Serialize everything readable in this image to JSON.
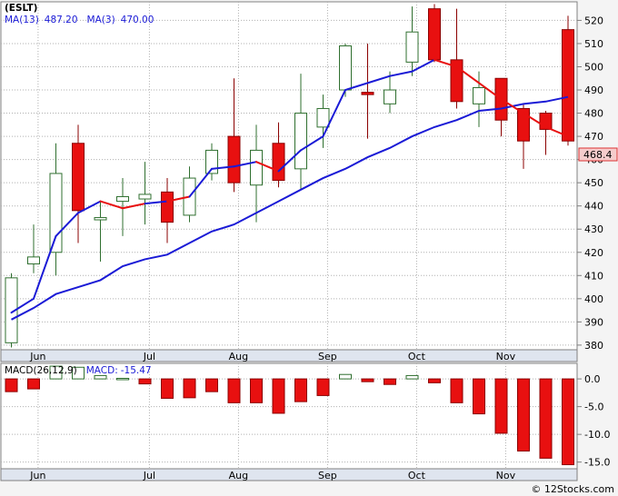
{
  "chart_data": [
    {
      "type": "candlestick",
      "ticker": "(ESLT)",
      "legend": [
        {
          "label": "MA(13)",
          "value": "487.20",
          "color": "#1a1ad6"
        },
        {
          "label": "MA(3)",
          "value": "470.00",
          "color": "#1a1ad6"
        }
      ],
      "last_price_label": "468.4",
      "ylim": [
        378,
        528
      ],
      "y_ticks": [
        380,
        390,
        400,
        410,
        420,
        430,
        440,
        450,
        460,
        470,
        480,
        490,
        500,
        510,
        520
      ],
      "x_ticks": [
        "Jun",
        "Jul",
        "Aug",
        "Sep",
        "Oct",
        "Nov"
      ],
      "x_tick_positions": [
        1.2,
        6.2,
        10.2,
        14.2,
        18.2,
        22.2
      ],
      "grid": true,
      "candles": [
        {
          "o": 381,
          "h": 411,
          "l": 379,
          "c": 409
        },
        {
          "o": 415,
          "h": 432,
          "l": 411,
          "c": 418
        },
        {
          "o": 420,
          "h": 467,
          "l": 410,
          "c": 454
        },
        {
          "o": 467,
          "h": 475,
          "l": 424,
          "c": 438
        },
        {
          "o": 434,
          "h": 442,
          "l": 416,
          "c": 435
        },
        {
          "o": 442,
          "h": 452,
          "l": 427,
          "c": 444
        },
        {
          "o": 443,
          "h": 459,
          "l": 432,
          "c": 445
        },
        {
          "o": 446,
          "h": 452,
          "l": 424,
          "c": 433
        },
        {
          "o": 436,
          "h": 457,
          "l": 433,
          "c": 452
        },
        {
          "o": 454,
          "h": 467,
          "l": 451,
          "c": 464
        },
        {
          "o": 470,
          "h": 495,
          "l": 446,
          "c": 450
        },
        {
          "o": 449,
          "h": 475,
          "l": 433,
          "c": 464
        },
        {
          "o": 467,
          "h": 476,
          "l": 448,
          "c": 451
        },
        {
          "o": 456,
          "h": 497,
          "l": 447,
          "c": 480
        },
        {
          "o": 474,
          "h": 488,
          "l": 465,
          "c": 482
        },
        {
          "o": 490,
          "h": 510,
          "l": 487,
          "c": 509
        },
        {
          "o": 489,
          "h": 510,
          "l": 469,
          "c": 488
        },
        {
          "o": 484,
          "h": 498,
          "l": 480,
          "c": 490
        },
        {
          "o": 502,
          "h": 526,
          "l": 496,
          "c": 515
        },
        {
          "o": 525,
          "h": 527,
          "l": 502,
          "c": 503
        },
        {
          "o": 503,
          "h": 525,
          "l": 482,
          "c": 485
        },
        {
          "o": 484,
          "h": 498,
          "l": 474,
          "c": 491
        },
        {
          "o": 495,
          "h": 495,
          "l": 470,
          "c": 477
        },
        {
          "o": 482,
          "h": 484,
          "l": 456,
          "c": 468
        },
        {
          "o": 480,
          "h": 481,
          "l": 462,
          "c": 473
        },
        {
          "o": 516,
          "h": 522,
          "l": 466,
          "c": 468
        }
      ],
      "series": [
        {
          "name": "MA(3)",
          "values": [
            394,
            400,
            427,
            437,
            442,
            439,
            441,
            442,
            444,
            456,
            457,
            459,
            455,
            464,
            470,
            490,
            493,
            496,
            498,
            503,
            500,
            493,
            486,
            480,
            474,
            470
          ],
          "segment_colors": [
            "blue",
            "blue",
            "blue",
            "blue",
            "red",
            "red",
            "blue",
            "red",
            "blue",
            "blue",
            "blue",
            "red",
            "blue",
            "blue",
            "blue",
            "blue",
            "blue",
            "blue",
            "blue",
            "red",
            "red",
            "red",
            "red",
            "red",
            "red"
          ]
        },
        {
          "name": "MA(13)",
          "values": [
            391,
            396,
            402,
            405,
            408,
            414,
            417,
            419,
            424,
            429,
            432,
            437,
            442,
            447,
            452,
            456,
            461,
            465,
            470,
            474,
            477,
            481,
            482,
            484,
            485,
            487
          ],
          "color": "#1a1ad6"
        }
      ]
    },
    {
      "type": "bar",
      "title": "MACD(26,12,9)",
      "legend": [
        {
          "label": "MACD:",
          "value": "-15.47",
          "color": "#1a1ad6"
        }
      ],
      "ylim": [
        -16.2,
        2.8
      ],
      "y_ticks": [
        0.0,
        -5.0,
        -10.0,
        -15.0
      ],
      "y_tick_labels": [
        "0.0",
        "-5.0",
        "-10.0",
        "-15.0"
      ],
      "x_ticks": [
        "Jun",
        "Jul",
        "Aug",
        "Sep",
        "Oct",
        "Nov"
      ],
      "values": [
        -2.3,
        -1.8,
        2.3,
        2.1,
        0.6,
        0.1,
        -0.9,
        -3.5,
        -3.4,
        -2.3,
        -4.3,
        -4.3,
        -6.2,
        -4.1,
        -3.0,
        0.8,
        -0.5,
        -1.0,
        0.6,
        -0.7,
        -4.3,
        -6.3,
        -9.8,
        -13.0,
        -14.3,
        -15.47
      ]
    }
  ],
  "footer": {
    "watermark": "© 12Stocks.com"
  }
}
